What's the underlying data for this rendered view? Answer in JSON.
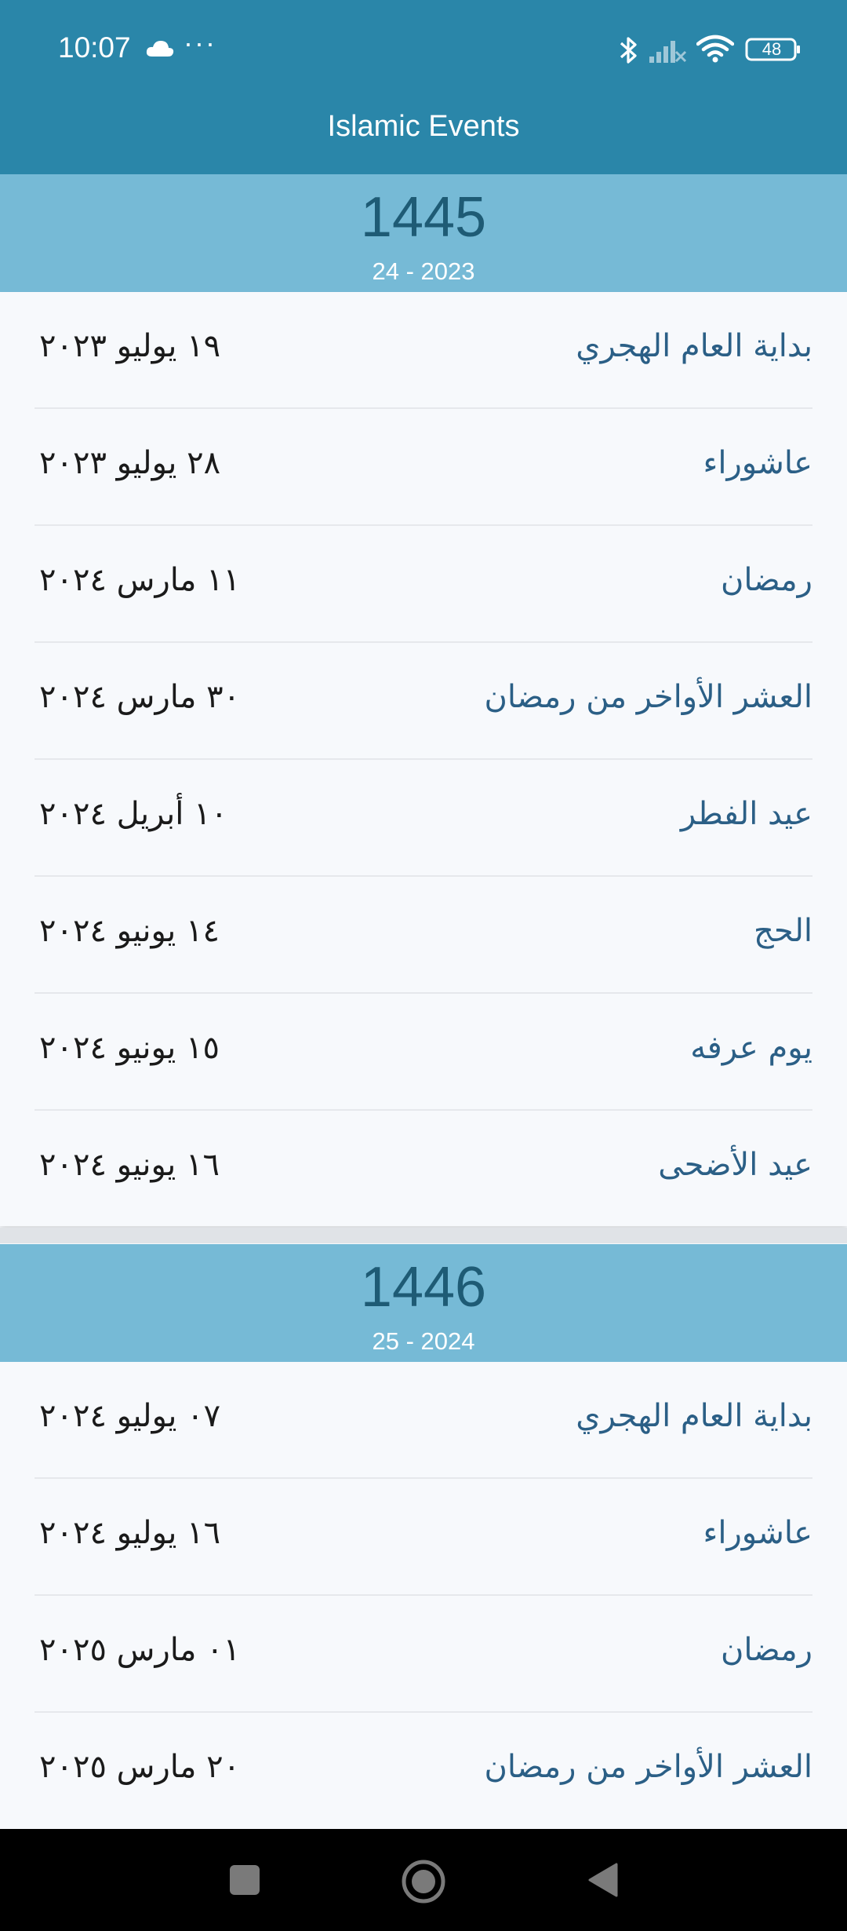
{
  "status_bar": {
    "time": "10:07",
    "battery": "48"
  },
  "app": {
    "title": "Islamic Events"
  },
  "years": [
    {
      "hijri_year": "1445",
      "gregorian_range": "24 - 2023",
      "events": [
        {
          "name": "بداية العام الهجري",
          "date": "١٩ يوليو ٢٠٢٣"
        },
        {
          "name": "عاشوراء",
          "date": "٢٨ يوليو ٢٠٢٣"
        },
        {
          "name": "رمضان",
          "date": "١١ مارس ٢٠٢٤"
        },
        {
          "name": "العشر الأواخر من رمضان",
          "date": "٣٠ مارس ٢٠٢٤"
        },
        {
          "name": "عيد الفطر",
          "date": "١٠ أبريل ٢٠٢٤"
        },
        {
          "name": "الحج",
          "date": "١٤ يونيو ٢٠٢٤"
        },
        {
          "name": "يوم عرفه",
          "date": "١٥ يونيو ٢٠٢٤"
        },
        {
          "name": "عيد الأضحى",
          "date": "١٦ يونيو ٢٠٢٤"
        }
      ]
    },
    {
      "hijri_year": "1446",
      "gregorian_range": "25 - 2024",
      "events": [
        {
          "name": "بداية العام الهجري",
          "date": "٠٧ يوليو ٢٠٢٤"
        },
        {
          "name": "عاشوراء",
          "date": "١٦ يوليو ٢٠٢٤"
        },
        {
          "name": "رمضان",
          "date": "٠١ مارس ٢٠٢٥"
        },
        {
          "name": "العشر الأواخر من رمضان",
          "date": "٢٠ مارس ٢٠٢٥"
        }
      ]
    }
  ],
  "icons": {
    "status": [
      "cloud-icon",
      "more-dots-icon",
      "bluetooth-icon",
      "signal-icon",
      "wifi-icon",
      "battery-icon"
    ],
    "navigation": [
      "recents-icon",
      "home-icon",
      "back-icon"
    ]
  },
  "colors": {
    "app_bar": "#2a86a9",
    "year_header": "#76bad6",
    "event_text": "#2b5f86"
  }
}
